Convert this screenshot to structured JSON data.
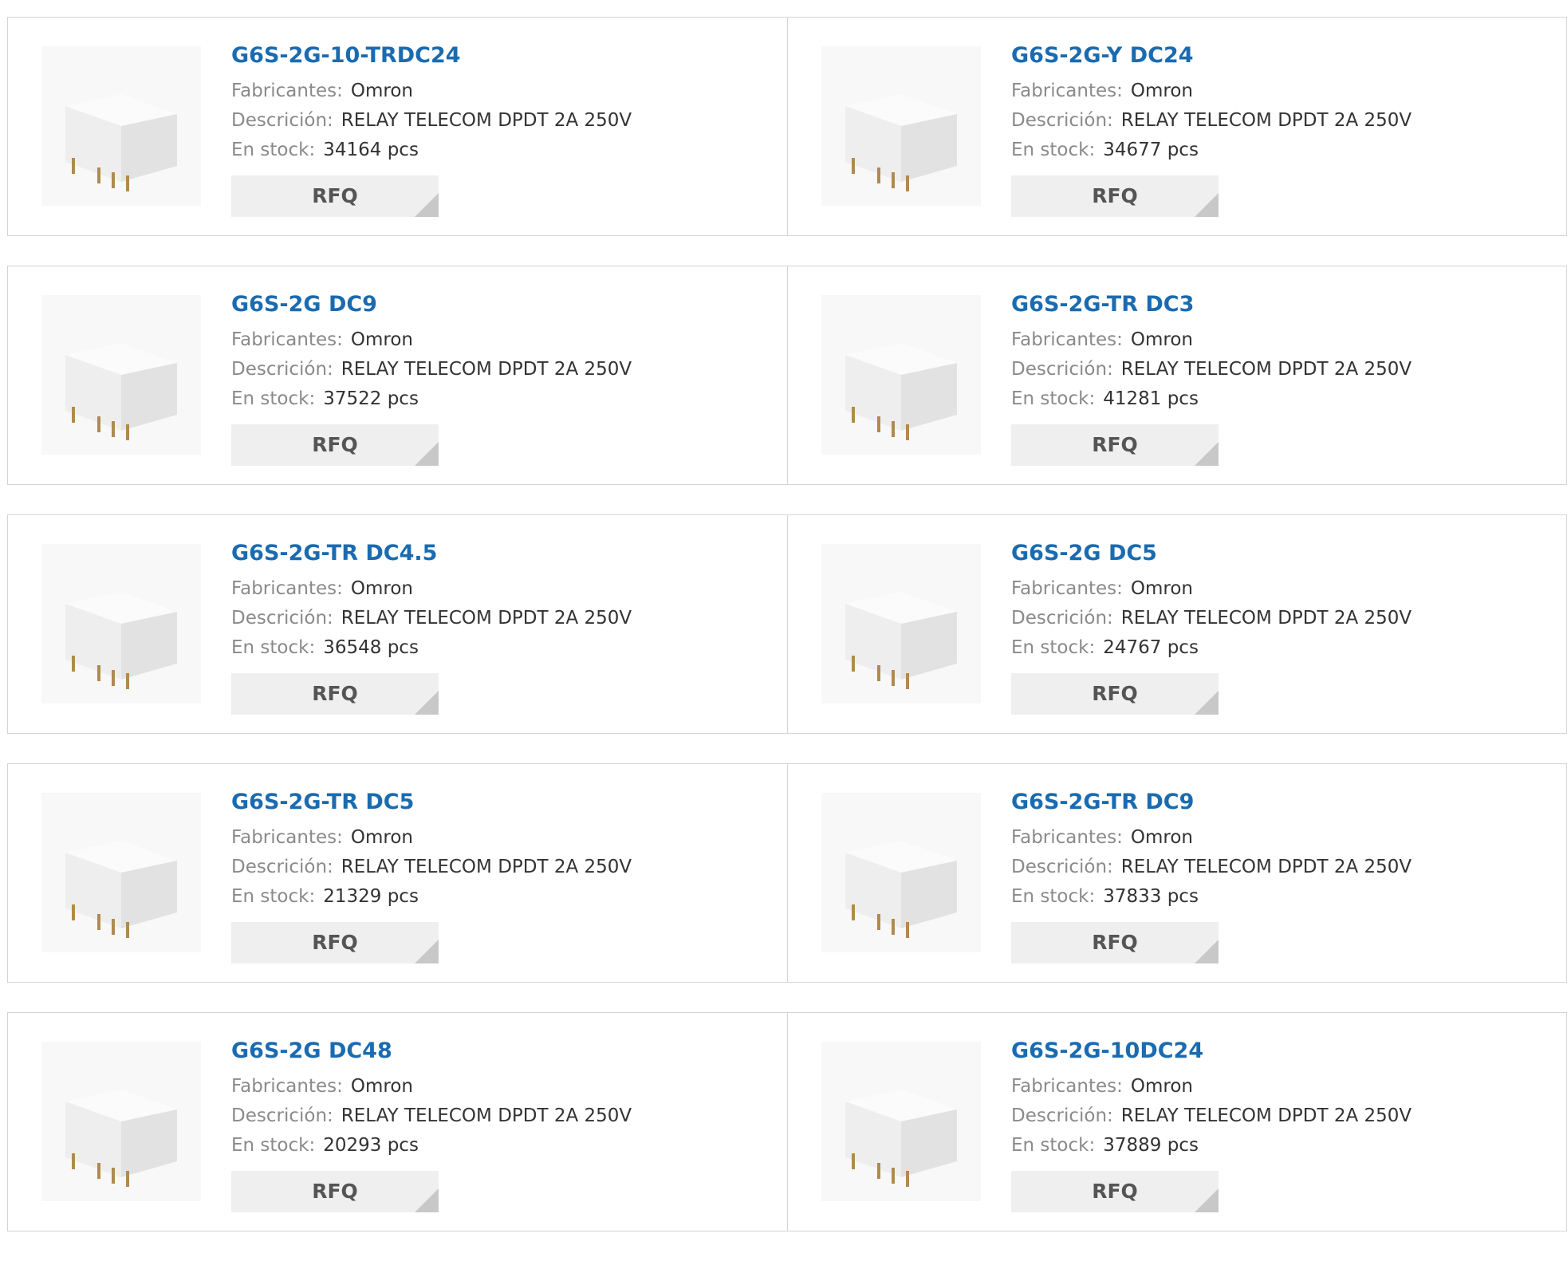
{
  "labels": {
    "manufacturer": "Fabricantes:",
    "description": "Descrición:",
    "stock": "En stock:"
  },
  "rfq_label": "RFQ",
  "products": [
    {
      "part": "G6S-2G-10-TRDC24",
      "manufacturer": "Omron",
      "description": "RELAY TELECOM DPDT 2A 250V",
      "stock": "34164 pcs"
    },
    {
      "part": "G6S-2G-Y DC24",
      "manufacturer": "Omron",
      "description": "RELAY TELECOM DPDT 2A 250V",
      "stock": "34677 pcs"
    },
    {
      "part": "G6S-2G DC9",
      "manufacturer": "Omron",
      "description": "RELAY TELECOM DPDT 2A 250V",
      "stock": "37522 pcs"
    },
    {
      "part": "G6S-2G-TR DC3",
      "manufacturer": "Omron",
      "description": "RELAY TELECOM DPDT 2A 250V",
      "stock": "41281 pcs"
    },
    {
      "part": "G6S-2G-TR DC4.5",
      "manufacturer": "Omron",
      "description": "RELAY TELECOM DPDT 2A 250V",
      "stock": "36548 pcs"
    },
    {
      "part": "G6S-2G DC5",
      "manufacturer": "Omron",
      "description": "RELAY TELECOM DPDT 2A 250V",
      "stock": "24767 pcs"
    },
    {
      "part": "G6S-2G-TR DC5",
      "manufacturer": "Omron",
      "description": "RELAY TELECOM DPDT 2A 250V",
      "stock": "21329 pcs"
    },
    {
      "part": "G6S-2G-TR DC9",
      "manufacturer": "Omron",
      "description": "RELAY TELECOM DPDT 2A 250V",
      "stock": "37833 pcs"
    },
    {
      "part": "G6S-2G DC48",
      "manufacturer": "Omron",
      "description": "RELAY TELECOM DPDT 2A 250V",
      "stock": "20293 pcs"
    },
    {
      "part": "G6S-2G-10DC24",
      "manufacturer": "Omron",
      "description": "RELAY TELECOM DPDT 2A 250V",
      "stock": "37889 pcs"
    }
  ],
  "colors": {
    "part_link": "#1a6bb0",
    "label": "#8a8a8a",
    "value": "#333333",
    "rfq_bg": "#efefef",
    "border": "#d4d4d4"
  },
  "icons": {
    "product_image": "relay-component-image",
    "rfq_corner": "triangle-corner-icon"
  }
}
